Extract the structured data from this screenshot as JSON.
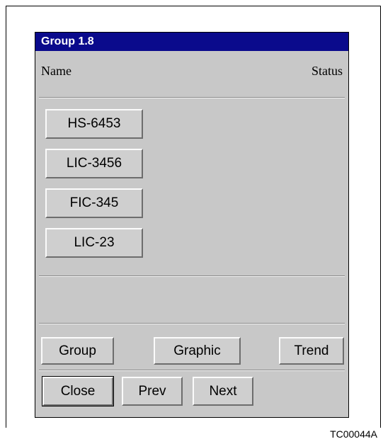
{
  "window": {
    "title": "Group 1.8"
  },
  "header": {
    "name_label": "Name",
    "status_label": "Status"
  },
  "items": [
    {
      "label": "HS-6453"
    },
    {
      "label": "LIC-3456"
    },
    {
      "label": "FIC-345"
    },
    {
      "label": "LIC-23"
    }
  ],
  "nav_buttons": {
    "group": "Group",
    "graphic": "Graphic",
    "trend": "Trend"
  },
  "action_buttons": {
    "close": "Close",
    "prev": "Prev",
    "next": "Next"
  },
  "figure_code": "TC00044A"
}
